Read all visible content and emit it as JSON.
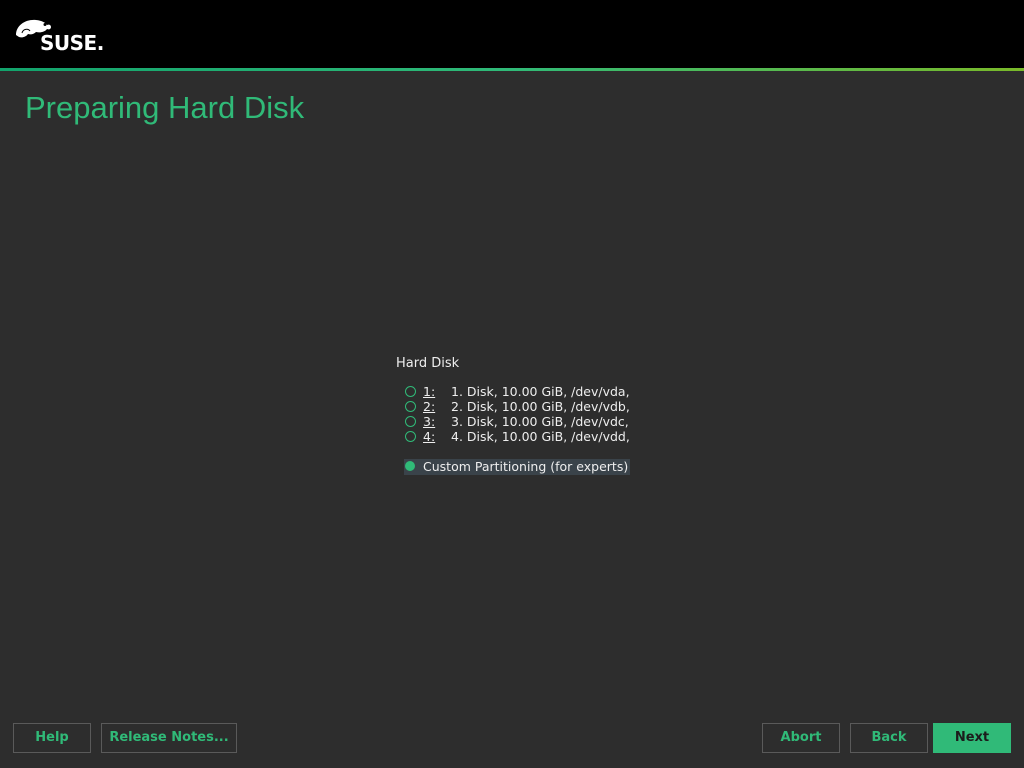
{
  "header": {
    "logo_text": "SUSE.",
    "accent_color": "#30ba78"
  },
  "page": {
    "title": "Preparing Hard Disk"
  },
  "hard_disk": {
    "label": "Hard Disk",
    "options": [
      {
        "shortcut": "1:",
        "text": "1. Disk, 10.00 GiB, /dev/vda,",
        "selected": false
      },
      {
        "shortcut": "2:",
        "text": "2. Disk, 10.00 GiB, /dev/vdb,",
        "selected": false
      },
      {
        "shortcut": "3:",
        "text": "3. Disk, 10.00 GiB, /dev/vdc,",
        "selected": false
      },
      {
        "shortcut": "4:",
        "text": "4. Disk, 10.00 GiB, /dev/vdd,",
        "selected": false
      }
    ],
    "custom_option": {
      "text": "Custom Partitioning (for experts)",
      "selected": true
    }
  },
  "buttons": {
    "help": "Help",
    "release_notes": "Release Notes...",
    "abort": "Abort",
    "back": "Back",
    "next": "Next"
  }
}
